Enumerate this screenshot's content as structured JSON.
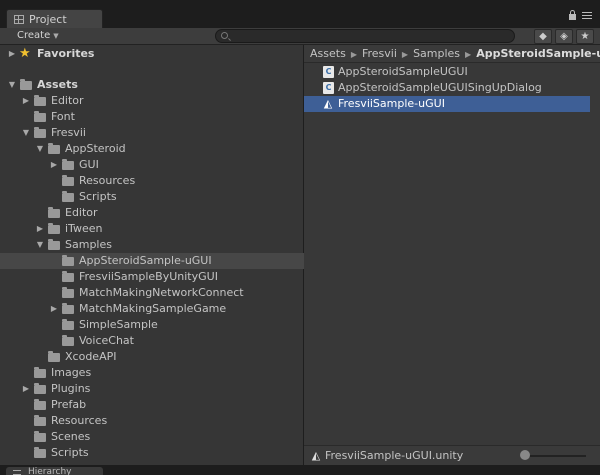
{
  "window": {
    "tab_label": "Project",
    "bottom_tab_label": "Hierarchy"
  },
  "toolbar": {
    "create_label": "Create",
    "search_value": "",
    "search_placeholder": ""
  },
  "tree": {
    "favorites": "Favorites",
    "assets": "Assets",
    "items": [
      {
        "label": "Editor"
      },
      {
        "label": "Font"
      },
      {
        "label": "Fresvii"
      },
      {
        "label": "AppSteroid"
      },
      {
        "label": "GUI"
      },
      {
        "label": "Resources"
      },
      {
        "label": "Scripts"
      },
      {
        "label": "Editor"
      },
      {
        "label": "iTween"
      },
      {
        "label": "Samples"
      },
      {
        "label": "AppSteroidSample-uGUI"
      },
      {
        "label": "FresviiSampleByUnityGUI"
      },
      {
        "label": "MatchMakingNetworkConnect"
      },
      {
        "label": "MatchMakingSampleGame"
      },
      {
        "label": "SimpleSample"
      },
      {
        "label": "VoiceChat"
      },
      {
        "label": "XcodeAPI"
      },
      {
        "label": "Images"
      },
      {
        "label": "Plugins"
      },
      {
        "label": "Prefab"
      },
      {
        "label": "Resources"
      },
      {
        "label": "Scenes"
      },
      {
        "label": "Scripts"
      }
    ]
  },
  "breadcrumb": [
    "Assets",
    "Fresvii",
    "Samples",
    "AppSteroidSample-uGUI"
  ],
  "files": [
    {
      "name": "AppSteroidSampleUGUI",
      "icon": "script-icon"
    },
    {
      "name": "AppSteroidSampleUGUISingUpDialog",
      "icon": "script-icon"
    },
    {
      "name": "FresviiSample-uGUI",
      "icon": "unity-scene-icon"
    }
  ],
  "status": {
    "selected_file": "FresviiSample-uGUI.unity"
  },
  "colors": {
    "selection": "#3e5f96",
    "panel": "#383838"
  }
}
